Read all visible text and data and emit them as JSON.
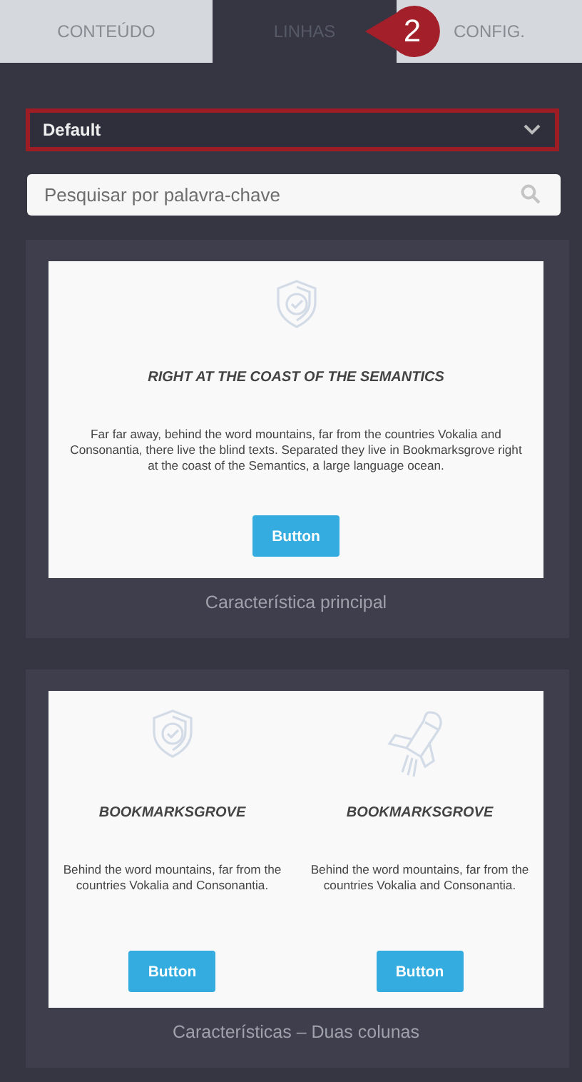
{
  "tabs": [
    {
      "label": "CONTEÚDO",
      "selected": false
    },
    {
      "label": "LINHAS",
      "selected": true
    },
    {
      "label": "CONFIG.",
      "selected": false
    }
  ],
  "step_badge": "2",
  "layout_select": {
    "value": "Default",
    "highlighted": true
  },
  "search": {
    "placeholder": "Pesquisar por palavra-chave"
  },
  "templates": [
    {
      "caption": "Característica principal",
      "columns": [
        {
          "heading": "RIGHT AT THE COAST OF THE SEMANTICS",
          "text": "Far far away, behind the word mountains, far from the countries Vokalia and Consonantia, there live the blind texts. Separated they live in Bookmarksgrove right at the coast of the Semantics, a large language ocean.",
          "button": "Button"
        }
      ]
    },
    {
      "caption": "Características – Duas colunas",
      "columns": [
        {
          "heading": "BOOKMARKSGROVE",
          "text": "Behind the word mountains, far from the countries Vokalia and Consonantia.",
          "button": "Button"
        },
        {
          "heading": "BOOKMARKSGROVE",
          "text": "Behind the word mountains, far from the countries Vokalia and Consonantia.",
          "button": "Button"
        }
      ]
    }
  ]
}
